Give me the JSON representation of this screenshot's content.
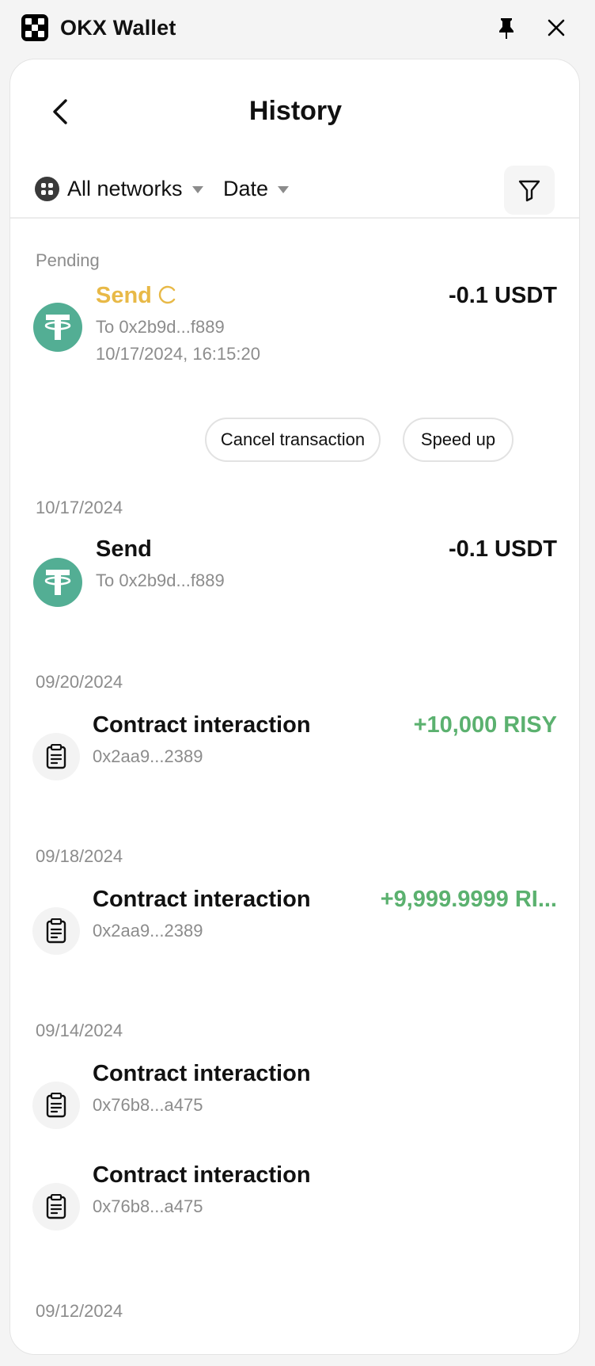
{
  "window": {
    "app_title": "OKX Wallet"
  },
  "header": {
    "title": "History"
  },
  "filters": {
    "network": "All networks",
    "date": "Date"
  },
  "sections": {
    "pending": "Pending",
    "d1": "10/17/2024",
    "d2": "09/20/2024",
    "d3": "09/18/2024",
    "d4": "09/14/2024",
    "d5": "09/12/2024"
  },
  "pending_tx": {
    "title": "Send",
    "to": "To 0x2b9d...f889",
    "timestamp": "10/17/2024, 16:15:20",
    "amount": "-0.1 USDT",
    "cancel_label": "Cancel transaction",
    "speed_up_label": "Speed up"
  },
  "transactions": [
    {
      "title": "Send",
      "sub": "To 0x2b9d...f889",
      "amount": "-0.1 USDT",
      "icon": "usdt-icon"
    },
    {
      "title": "Contract interaction",
      "sub": "0x2aa9...2389",
      "amount": "+10,000 RISY",
      "icon": "clipboard-icon"
    },
    {
      "title": "Contract interaction",
      "sub": "0x2aa9...2389",
      "amount": "+9,999.9999 RI...",
      "icon": "clipboard-icon"
    },
    {
      "title": "Contract interaction",
      "sub": "0x76b8...a475",
      "amount": "",
      "icon": "clipboard-icon"
    },
    {
      "title": "Contract interaction",
      "sub": "0x76b8...a475",
      "amount": "",
      "icon": "clipboard-icon"
    }
  ],
  "colors": {
    "pending": "#e8b947",
    "positive": "#5bb16f",
    "usdt": "#53ae94",
    "muted": "#8c8c8c"
  }
}
